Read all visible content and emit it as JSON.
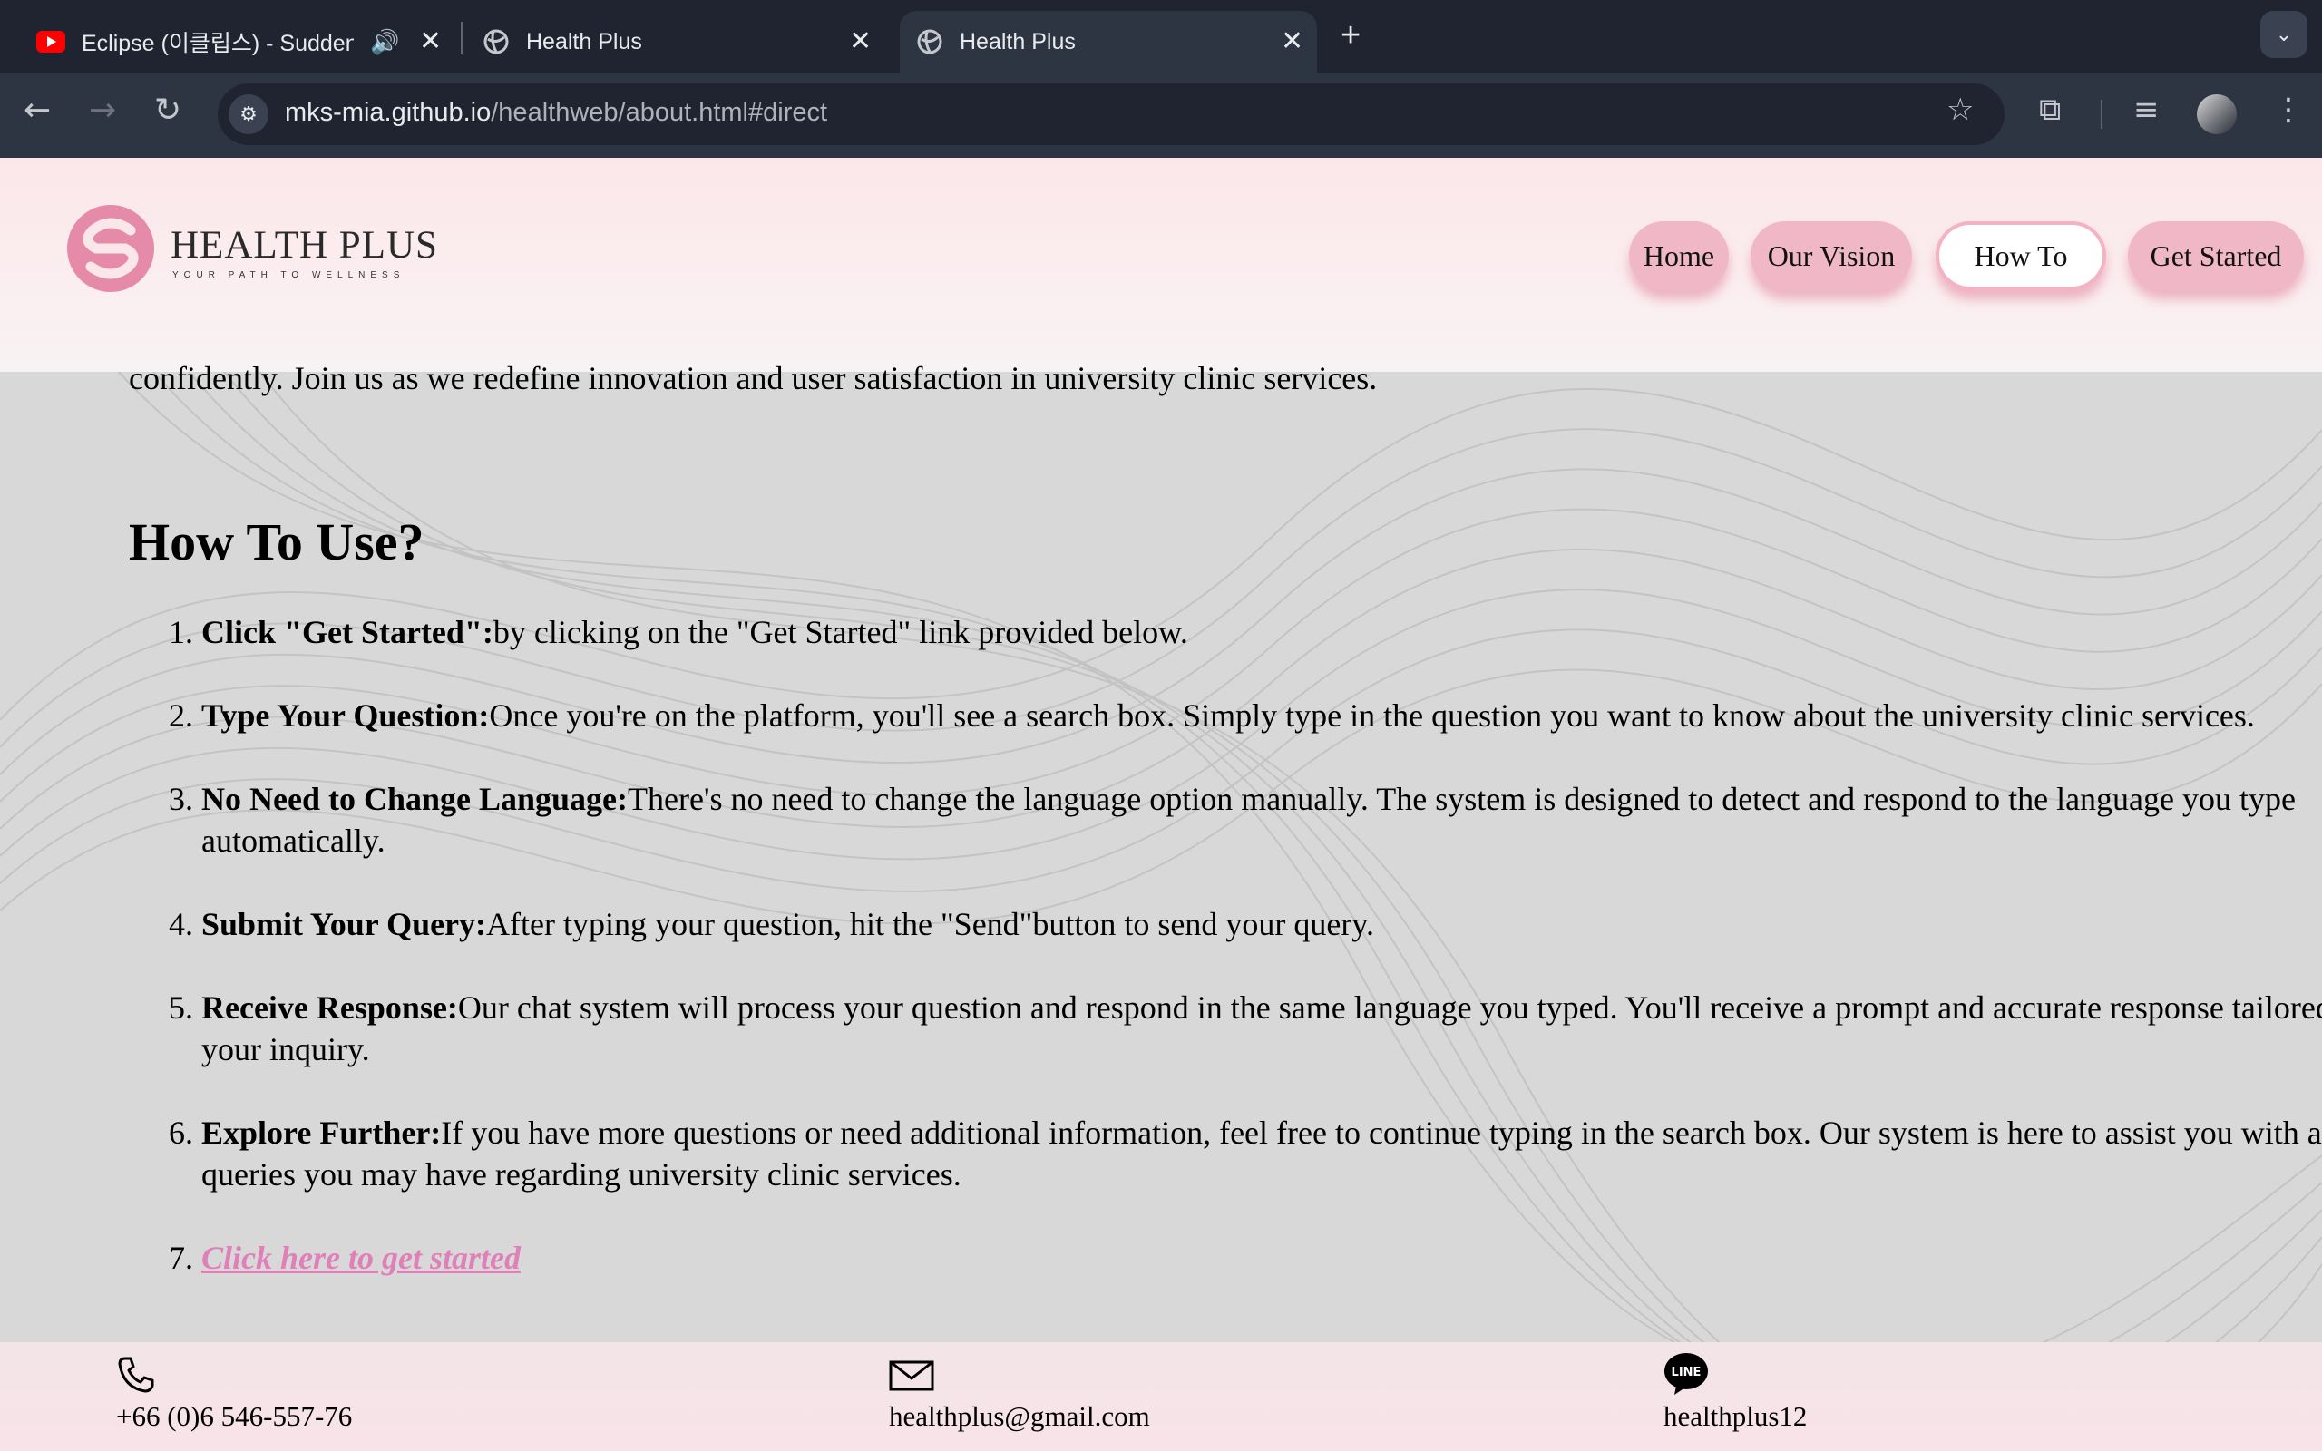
{
  "browser": {
    "tabs": [
      {
        "title": "Eclipse (이클립스) - Sudden",
        "favicon": "youtube-icon",
        "audio": true
      },
      {
        "title": "Health Plus",
        "favicon": "globe-icon"
      },
      {
        "title": "Health Plus",
        "favicon": "globe-icon",
        "active": true
      }
    ],
    "url_host": "mks-mia.github.io",
    "url_path": "/healthweb/about.html#direct"
  },
  "site": {
    "logo_title": "HEALTH PLUS",
    "logo_tagline": "YOUR PATH TO WELLNESS",
    "nav": [
      {
        "label": "Home"
      },
      {
        "label": "Our Vision"
      },
      {
        "label": "How To",
        "active": true
      },
      {
        "label": "Get Started"
      }
    ],
    "colors": {
      "accent_pink": "#f0b8c6",
      "link_pink": "#e080b8",
      "logo_pink": "#e58aa8"
    }
  },
  "content": {
    "intro_tail": "confidently. Join us as we redefine innovation and user satisfaction in university clinic services.",
    "heading": "How To Use?",
    "steps": [
      {
        "bold": "Click \"Get Started\":",
        "text": "by clicking on the \"Get Started\" link provided below."
      },
      {
        "bold": "Type Your Question:",
        "text": "Once you're on the platform, you'll see a search box. Simply type in the question you want to know about the university clinic services."
      },
      {
        "bold": "No Need to Change Language:",
        "text": "There's no need to change the language option manually. The system is designed to detect and respond to the language you type automatically."
      },
      {
        "bold": "Submit Your Query:",
        "text": "After typing your question, hit the \"Send\"button to send your query."
      },
      {
        "bold": "Receive Response:",
        "text": "Our chat system will process your question and respond in the same language you typed. You'll receive a prompt and accurate response tailored to your inquiry."
      },
      {
        "bold": "Explore Further:",
        "text": "If you have more questions or need additional information, feel free to continue typing in the search box. Our system is here to assist you with any queries you may have regarding university clinic services."
      }
    ],
    "cta_label": "Click here to get started"
  },
  "footer": {
    "phone": "+66 (0)6 546-557-76",
    "email": "healthplus@gmail.com",
    "line": "healthplus12"
  }
}
